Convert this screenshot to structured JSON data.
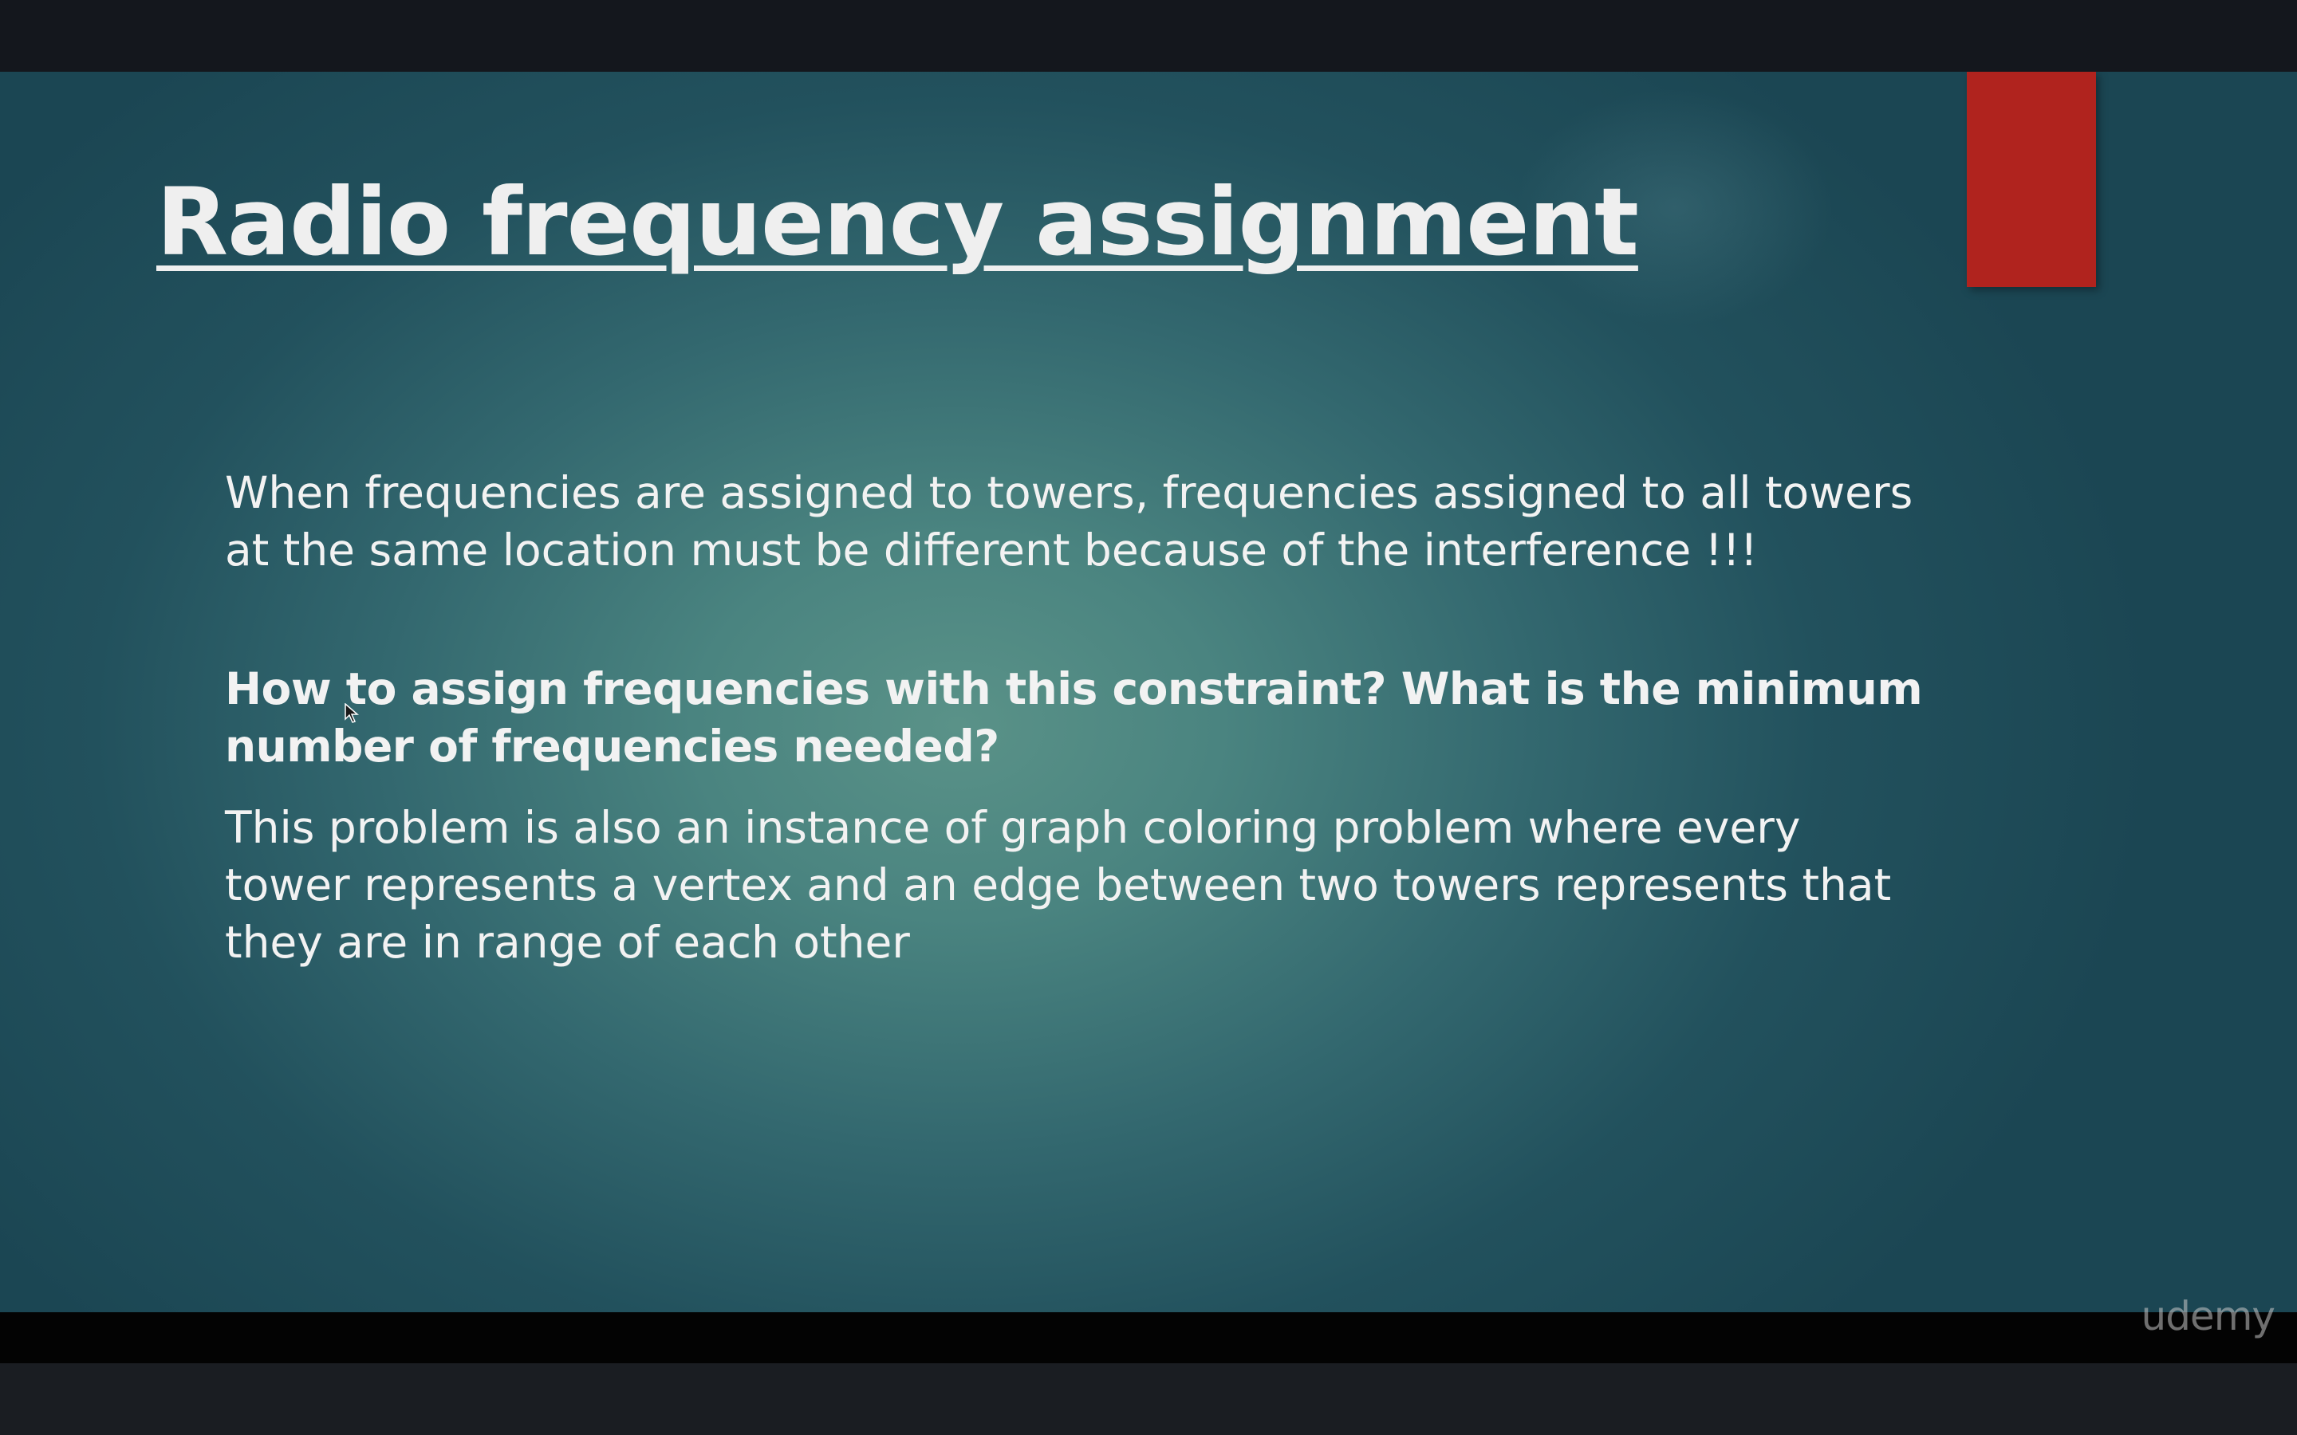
{
  "slide": {
    "title": "Radio frequency assignment",
    "paragraphs": [
      "When frequencies are assigned to towers, frequencies assigned to all towers at the same location must be different because of the interference !!!",
      "How to assign frequencies with this constraint? What is the minimum number of frequencies needed?",
      "This problem is also an instance of graph coloring problem where every tower represents a vertex and an edge between two towers represents that they are in range of each other"
    ],
    "accent_color": "#b0231e"
  },
  "watermark": "udemy",
  "cursor_icon": "pointer-arrow-icon"
}
